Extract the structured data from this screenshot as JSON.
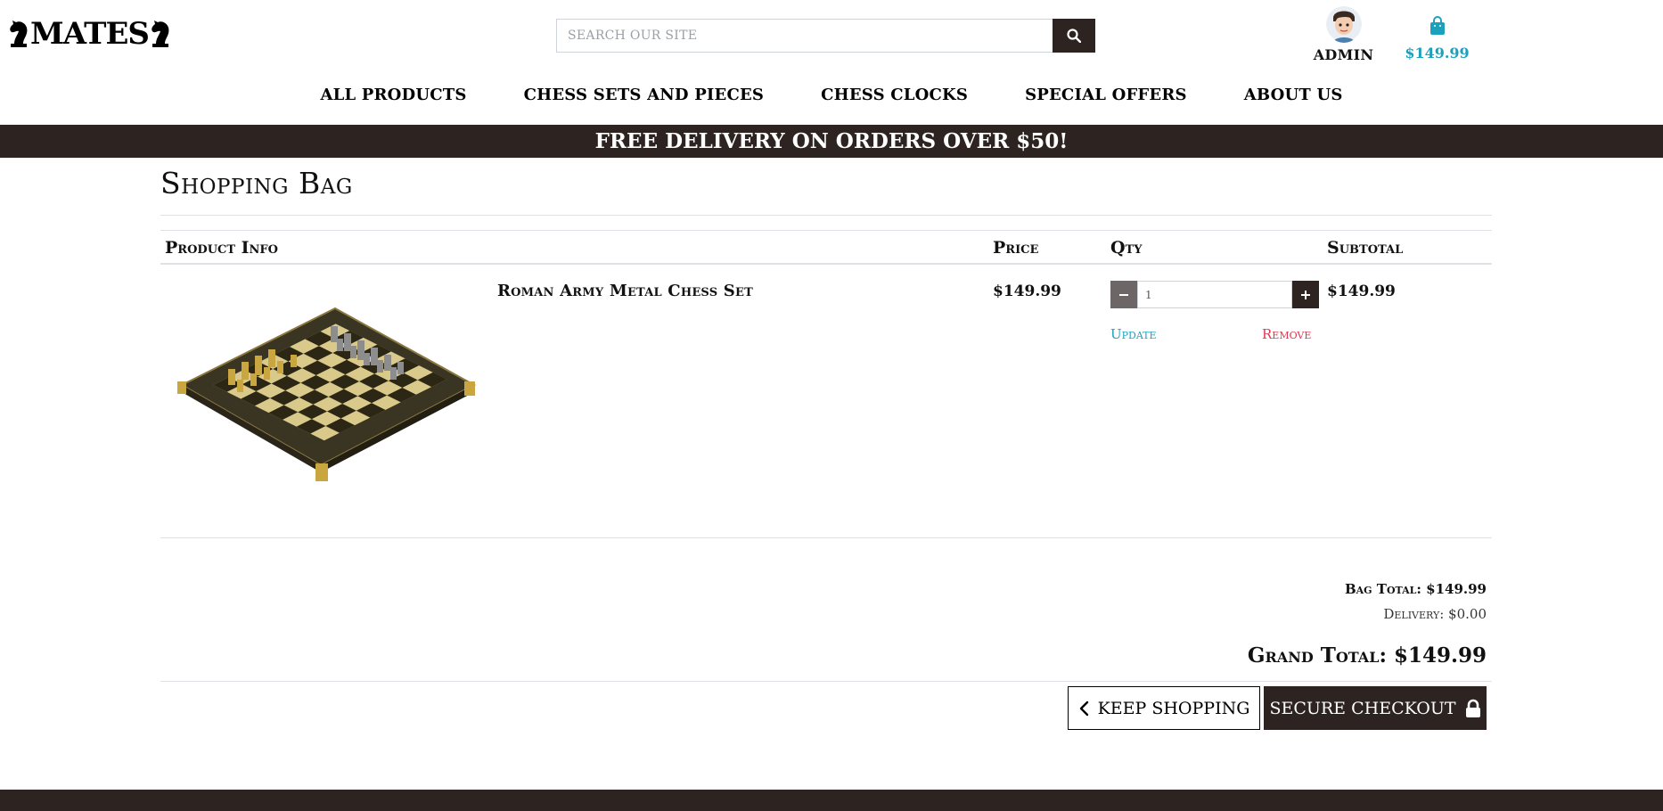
{
  "header": {
    "logo_text": "MATES",
    "search_placeholder": "SEARCH OUR SITE",
    "account_label": "ADMIN",
    "bag_total": "$149.99"
  },
  "nav": {
    "items": [
      {
        "label": "ALL PRODUCTS"
      },
      {
        "label": "CHESS SETS AND PIECES"
      },
      {
        "label": "CHESS CLOCKS"
      },
      {
        "label": "SPECIAL OFFERS"
      },
      {
        "label": "ABOUT US"
      }
    ]
  },
  "banner": {
    "text": "FREE DELIVERY ON ORDERS OVER $50!"
  },
  "page": {
    "title": "Shopping Bag"
  },
  "table": {
    "headers": {
      "product": "Product Info",
      "price": "Price",
      "qty": "Qty",
      "subtotal": "Subtotal"
    },
    "rows": [
      {
        "name": "Roman Army Metal Chess Set",
        "price": "$149.99",
        "qty": "1",
        "subtotal": "$149.99",
        "update_label": "Update",
        "remove_label": "Remove"
      }
    ]
  },
  "totals": {
    "bag_total": "Bag Total: $149.99",
    "delivery": "Delivery: $0.00",
    "grand_total": "Grand Total: $149.99"
  },
  "actions": {
    "keep_shopping": "KEEP SHOPPING",
    "checkout": "SECURE CHECKOUT"
  },
  "colors": {
    "brand_dark": "#2d2421",
    "accent": "#1ca1bd",
    "danger": "#e0354f"
  },
  "icons": {
    "search": "search-icon",
    "bag": "shopping-bag-icon",
    "back": "chevron-left-icon",
    "lock": "lock-icon"
  }
}
